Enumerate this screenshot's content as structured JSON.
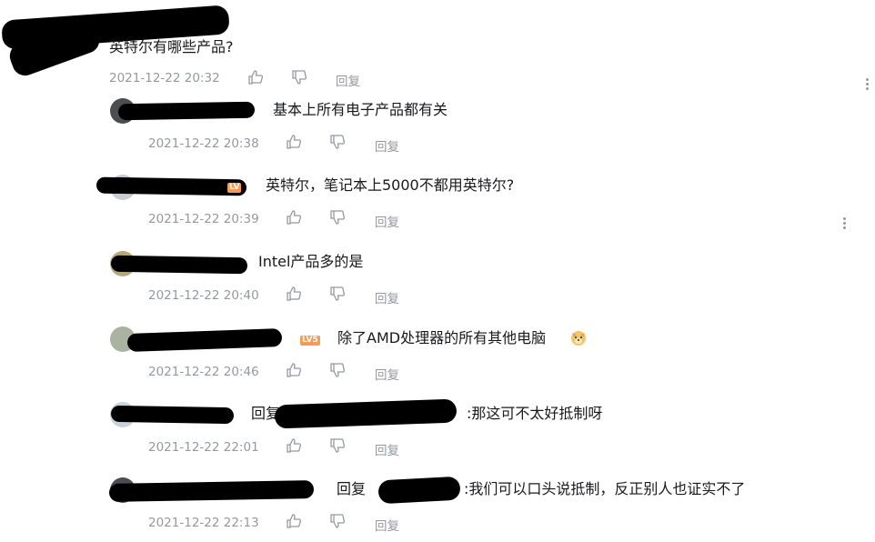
{
  "main_comment": {
    "text": "英特尔有哪些产品?",
    "time": "2021-12-22 20:32",
    "reply_label": "回复"
  },
  "replies": [
    {
      "text": "基本上所有电子产品都有关",
      "time": "2021-12-22 20:38",
      "reply_label": "回复"
    },
    {
      "text": "英特尔，笔记本上5000不都用英特尔?",
      "time": "2021-12-22 20:39",
      "reply_label": "回复"
    },
    {
      "text": "Intel产品多的是",
      "time": "2021-12-22 20:40",
      "reply_label": "回复"
    },
    {
      "text": "除了AMD处理器的所有其他电脑",
      "time": "2021-12-22 20:46",
      "reply_label": "回复"
    },
    {
      "prefix": "回复",
      "text": ":那这可不太好抵制呀",
      "time": "2021-12-22 22:01",
      "reply_label": "回复"
    },
    {
      "prefix": "回复",
      "text": ":我们可以口头说抵制，反正别人也证实不了",
      "time": "2021-12-22 22:13",
      "reply_label": "回复"
    }
  ],
  "icons": {
    "like": "thumbs-up-icon",
    "dislike": "thumbs-down-icon",
    "more": "more-vertical-icon",
    "emoji": "doge-emoji-icon"
  },
  "colors": {
    "meta": "#9499a0",
    "text": "#18191c",
    "badge": "#f69b57"
  }
}
